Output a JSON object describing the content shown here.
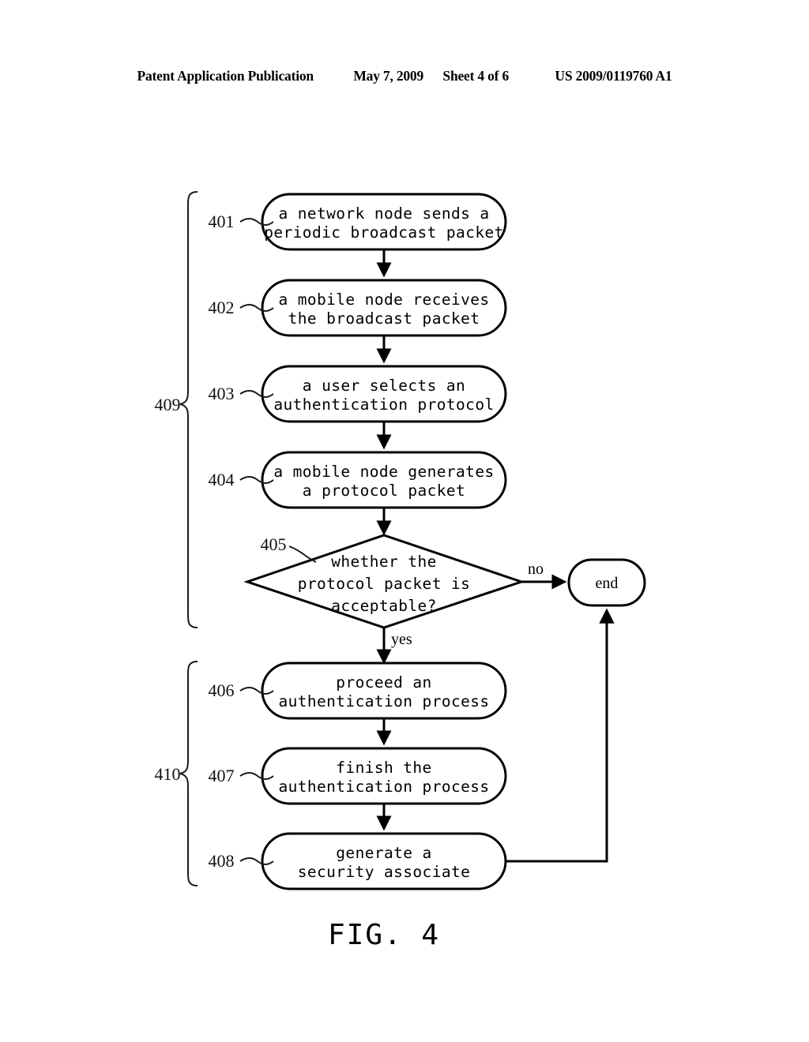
{
  "header": {
    "publication": "Patent Application Publication",
    "date": "May 7, 2009",
    "sheet": "Sheet 4 of 6",
    "document_number": "US 2009/0119760 A1"
  },
  "figure": {
    "caption": "FIG.  4",
    "nodes": [
      {
        "ref": "401",
        "shape": "rounded-rect",
        "line1": "a network node sends a",
        "line2": "periodic broadcast packet"
      },
      {
        "ref": "402",
        "shape": "rounded-rect",
        "line1": "a mobile node receives",
        "line2": "the broadcast packet"
      },
      {
        "ref": "403",
        "shape": "rounded-rect",
        "line1": "a user selects an",
        "line2": "authentication protocol"
      },
      {
        "ref": "404",
        "shape": "rounded-rect",
        "line1": "a mobile node generates",
        "line2": "a protocol packet"
      },
      {
        "ref": "405",
        "shape": "diamond",
        "line1": "whether the",
        "line2": "protocol packet is",
        "line3": "acceptable?"
      },
      {
        "ref": "406",
        "shape": "rounded-rect",
        "line1": "proceed an",
        "line2": "authentication process"
      },
      {
        "ref": "407",
        "shape": "rounded-rect",
        "line1": "finish the",
        "line2": "authentication process"
      },
      {
        "ref": "408",
        "shape": "rounded-rect",
        "line1": "generate a",
        "line2": "security associate"
      }
    ],
    "terminal": {
      "label": "end",
      "shape": "rounded-rect"
    },
    "branch_labels": {
      "yes": "yes",
      "no": "no"
    },
    "groups": [
      {
        "ref": "409",
        "covers": "401-405"
      },
      {
        "ref": "410",
        "covers": "406-408"
      }
    ]
  },
  "colors": {
    "ink": "#000000",
    "paper": "#ffffff",
    "leader": "#1a1a1a"
  }
}
